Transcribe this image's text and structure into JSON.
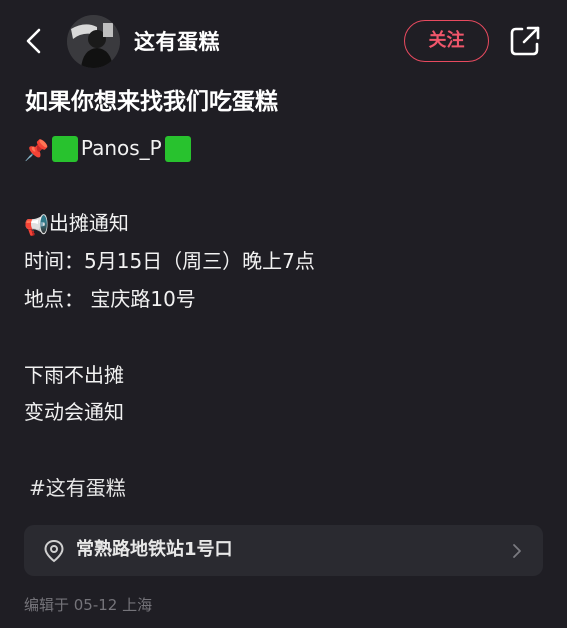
{
  "header": {
    "author_name": "这有蛋糕",
    "follow_label": "关注"
  },
  "post": {
    "title": "如果你想来找我们吃蛋糕",
    "pin_emoji": "📌",
    "pin_name": "Panos_P",
    "notice_emoji": "📢",
    "notice_heading": "出摊通知",
    "time_line": "时间：5月15日（周三）晚上7点",
    "place_line": "地点： 宝庆路10号",
    "rain_line": "下雨不出摊",
    "change_line": "变动会通知",
    "hashtag": "#这有蛋糕"
  },
  "location": {
    "name": "常熟路地铁站1号口"
  },
  "meta": {
    "edited": "编辑于 05-12 上海"
  },
  "colors": {
    "background": "#1f1e24",
    "accent": "#e84a5f",
    "card": "#2a2a30",
    "green_square": "#28c22e",
    "muted_text": "#75747a"
  }
}
